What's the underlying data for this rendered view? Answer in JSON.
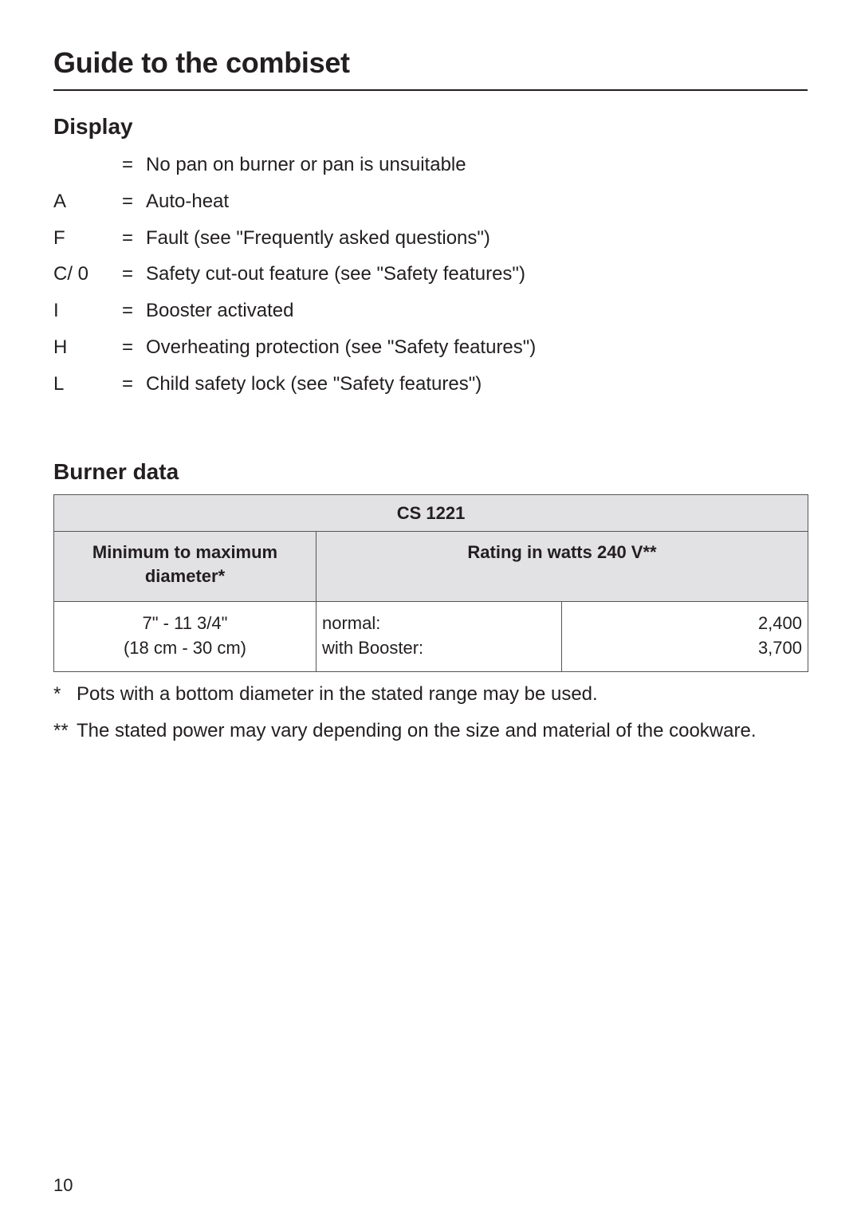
{
  "header": {
    "title": "Guide to the combiset"
  },
  "display": {
    "heading": "Display",
    "rows": [
      {
        "code": "",
        "eq": "=",
        "desc": "No pan on burner or pan is unsuitable"
      },
      {
        "code": "A",
        "eq": "=",
        "desc": "Auto-heat"
      },
      {
        "code": "F",
        "eq": "=",
        "desc": "Fault (see \"Frequently asked questions\")"
      },
      {
        "code": "C/ 0",
        "eq": "=",
        "desc": "Safety cut-out feature (see \"Safety features\")"
      },
      {
        "code": "I",
        "eq": "=",
        "desc": "Booster activated"
      },
      {
        "code": "H",
        "eq": "=",
        "desc": "Overheating protection (see \"Safety features\")"
      },
      {
        "code": "L",
        "eq": "=",
        "desc": "Child safety lock (see \"Safety features\")"
      }
    ]
  },
  "burner": {
    "heading": "Burner data",
    "model": "CS 1221",
    "columns": {
      "diameter": "Minimum to maximum diameter*",
      "rating": "Rating in watts 240 V**"
    },
    "diameter": {
      "inches": "7\" - 11 3/4\"",
      "cm": "(18 cm - 30 cm)"
    },
    "ratings": [
      {
        "label": "normal:",
        "value": "2,400"
      },
      {
        "label": "with Booster:",
        "value": "3,700"
      }
    ]
  },
  "footnotes": [
    {
      "mark": "*",
      "text": "Pots with a bottom diameter in the stated range may be used."
    },
    {
      "mark": "**",
      "text": "The stated power may vary depending on the size and material of the cookware."
    }
  ],
  "page": {
    "number": "10"
  }
}
